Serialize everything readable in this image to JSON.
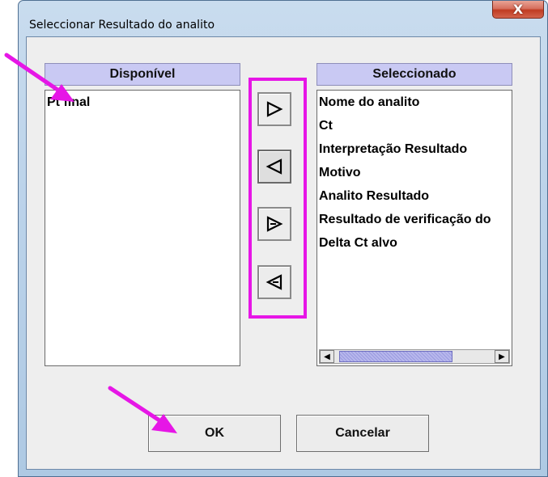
{
  "dialog": {
    "title": "Seleccionar Resultado do analito",
    "close_glyph": "X"
  },
  "available": {
    "header": "Disponível",
    "items": [
      "Pt final"
    ]
  },
  "selected": {
    "header": "Seleccionado",
    "items": [
      "Nome do analito",
      "Ct",
      "Interpretação Resultado",
      "Motivo",
      "Analito Resultado",
      "Resultado de verificação do",
      "Delta Ct alvo"
    ]
  },
  "buttons": {
    "ok": "OK",
    "cancel": "Cancelar"
  },
  "colors": {
    "annotation": "#e616e6",
    "header_bg": "#c9c9f3"
  }
}
